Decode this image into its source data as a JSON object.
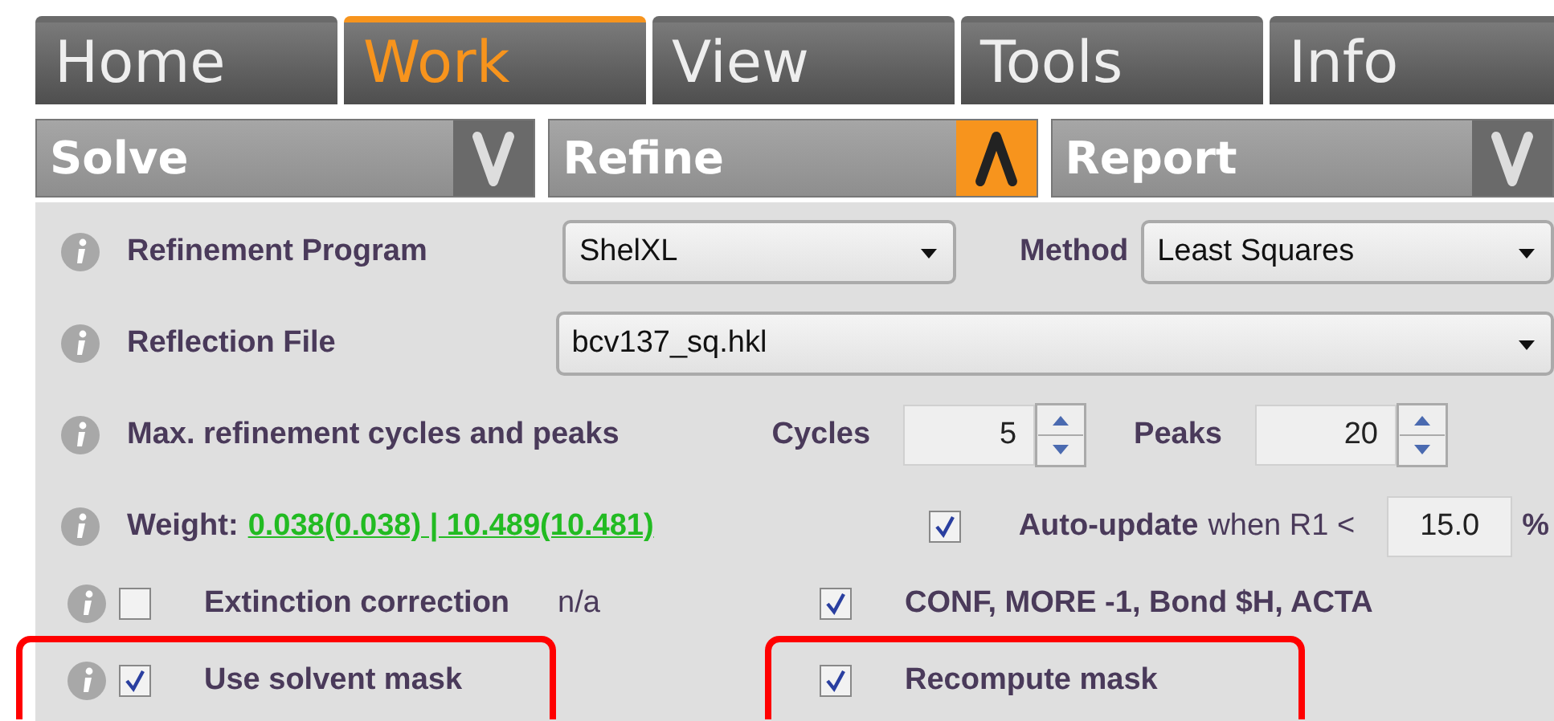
{
  "tabs": [
    {
      "label": "Home",
      "selected": false
    },
    {
      "label": "Work",
      "selected": true
    },
    {
      "label": "View",
      "selected": false
    },
    {
      "label": "Tools",
      "selected": false
    },
    {
      "label": "Info",
      "selected": false
    }
  ],
  "sections": [
    {
      "label": "Solve",
      "expanded": false
    },
    {
      "label": "Refine",
      "expanded": true
    },
    {
      "label": "Report",
      "expanded": false
    }
  ],
  "refinement_program": {
    "label": "Refinement Program",
    "value": "ShelXL"
  },
  "method": {
    "label": "Method",
    "value": "Least Squares"
  },
  "reflection_file": {
    "label": "Reflection File",
    "value": "bcv137_sq.hkl"
  },
  "max_cycles": {
    "label": "Max. refinement cycles and peaks",
    "cycles_label": "Cycles",
    "cycles": "5",
    "peaks_label": "Peaks",
    "peaks": "20"
  },
  "weight": {
    "label": "Weight:",
    "value": "0.038(0.038) | 10.489(10.481)"
  },
  "auto_update": {
    "checked": true,
    "label": "Auto-update",
    "suffix": "when R1 <",
    "value": "15.0",
    "unit": "%"
  },
  "option_rows": [
    {
      "left": {
        "label": "Extinction correction",
        "checked": false,
        "note": "n/a",
        "highlighted": false
      },
      "right": {
        "label": "CONF, MORE -1, Bond $H, ACTA",
        "checked": true,
        "highlighted": false
      }
    },
    {
      "left": {
        "label": "Use solvent mask",
        "checked": true,
        "highlighted": true
      },
      "right": {
        "label": "Recompute mask",
        "checked": true,
        "highlighted": true
      }
    }
  ]
}
